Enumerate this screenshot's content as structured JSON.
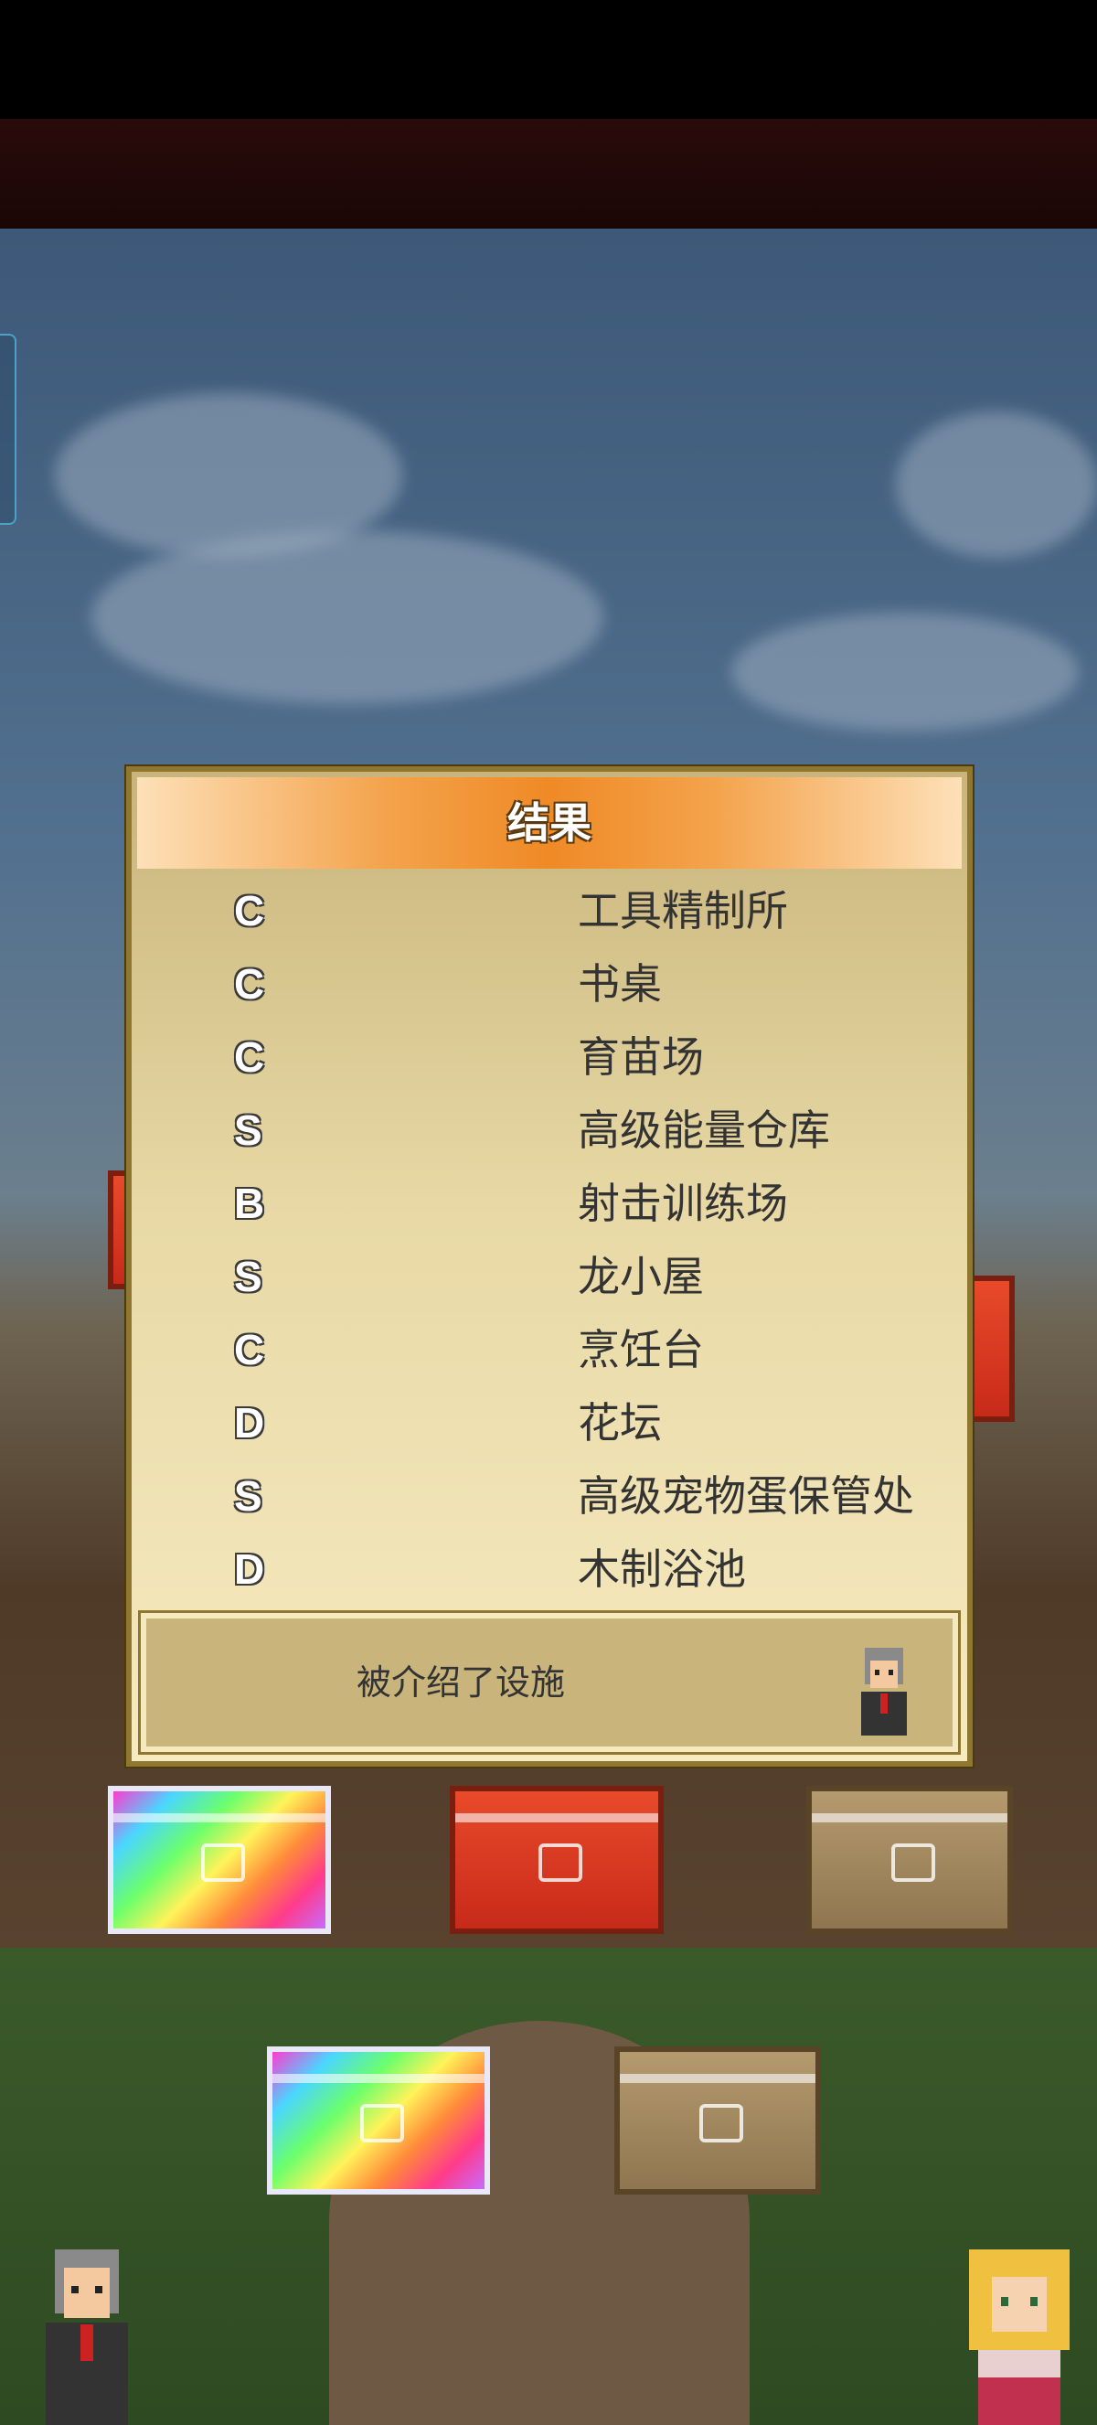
{
  "dialog": {
    "title": "结果",
    "rows": [
      {
        "grade": "C",
        "facility": "工具精制所"
      },
      {
        "grade": "C",
        "facility": "书桌"
      },
      {
        "grade": "C",
        "facility": "育苗场"
      },
      {
        "grade": "S",
        "facility": "高级能量仓库"
      },
      {
        "grade": "B",
        "facility": "射击训练场"
      },
      {
        "grade": "S",
        "facility": "龙小屋"
      },
      {
        "grade": "C",
        "facility": "烹饪台"
      },
      {
        "grade": "D",
        "facility": "花坛"
      },
      {
        "grade": "S",
        "facility": "高级宠物蛋保管处"
      },
      {
        "grade": "D",
        "facility": "木制浴池"
      }
    ],
    "message": "被介绍了设施"
  },
  "chests": [
    "rainbow-chest",
    "red-chest",
    "wood-chest",
    "rainbow-chest",
    "wood-chest"
  ],
  "colors": {
    "header_orange": "#ef8a26",
    "panel_gold": "#e8d9a6",
    "border": "#8f7730"
  }
}
